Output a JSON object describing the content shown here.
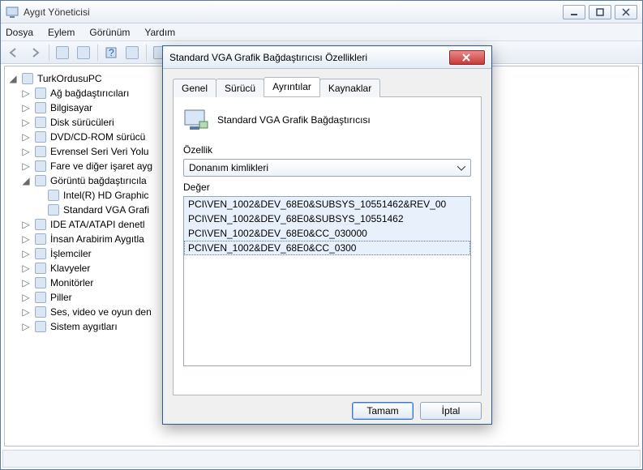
{
  "window": {
    "title": "Aygıt Yöneticisi"
  },
  "menu": {
    "items": [
      "Dosya",
      "Eylem",
      "Görünüm",
      "Yardım"
    ]
  },
  "tree": {
    "root": "TurkOrdusuPC",
    "nodes": [
      {
        "label": "Ağ bağdaştırıcıları",
        "children": []
      },
      {
        "label": "Bilgisayar",
        "children": []
      },
      {
        "label": "Disk sürücüleri",
        "children": []
      },
      {
        "label": "DVD/CD-ROM sürücü",
        "children": []
      },
      {
        "label": "Evrensel Seri Veri Yolu",
        "children": []
      },
      {
        "label": "Fare ve diğer işaret ayg",
        "children": []
      },
      {
        "label": "Görüntü bağdaştırıcıla",
        "expanded": true,
        "children": [
          {
            "label": "Intel(R) HD Graphic"
          },
          {
            "label": "Standard VGA Grafi"
          }
        ]
      },
      {
        "label": "IDE ATA/ATAPI denetl",
        "children": []
      },
      {
        "label": "İnsan Arabirim Aygıtla",
        "children": []
      },
      {
        "label": "İşlemciler",
        "children": []
      },
      {
        "label": "Klavyeler",
        "children": []
      },
      {
        "label": "Monitörler",
        "children": []
      },
      {
        "label": "Piller",
        "children": []
      },
      {
        "label": "Ses, video ve oyun den",
        "children": []
      },
      {
        "label": "Sistem aygıtları",
        "children": []
      }
    ]
  },
  "dialog": {
    "title": "Standard VGA Grafik Bağdaştırıcısı Özellikleri",
    "tabs": [
      "Genel",
      "Sürücü",
      "Ayrıntılar",
      "Kaynaklar"
    ],
    "active_tab": 2,
    "device_name": "Standard VGA Grafik Bağdaştırıcısı",
    "property_label": "Özellik",
    "property_value": "Donanım kimlikleri",
    "value_label": "Değer",
    "values": [
      "PCI\\VEN_1002&DEV_68E0&SUBSYS_10551462&REV_00",
      "PCI\\VEN_1002&DEV_68E0&SUBSYS_10551462",
      "PCI\\VEN_1002&DEV_68E0&CC_030000",
      "PCI\\VEN_1002&DEV_68E0&CC_0300"
    ],
    "buttons": {
      "ok": "Tamam",
      "cancel": "İptal"
    }
  }
}
